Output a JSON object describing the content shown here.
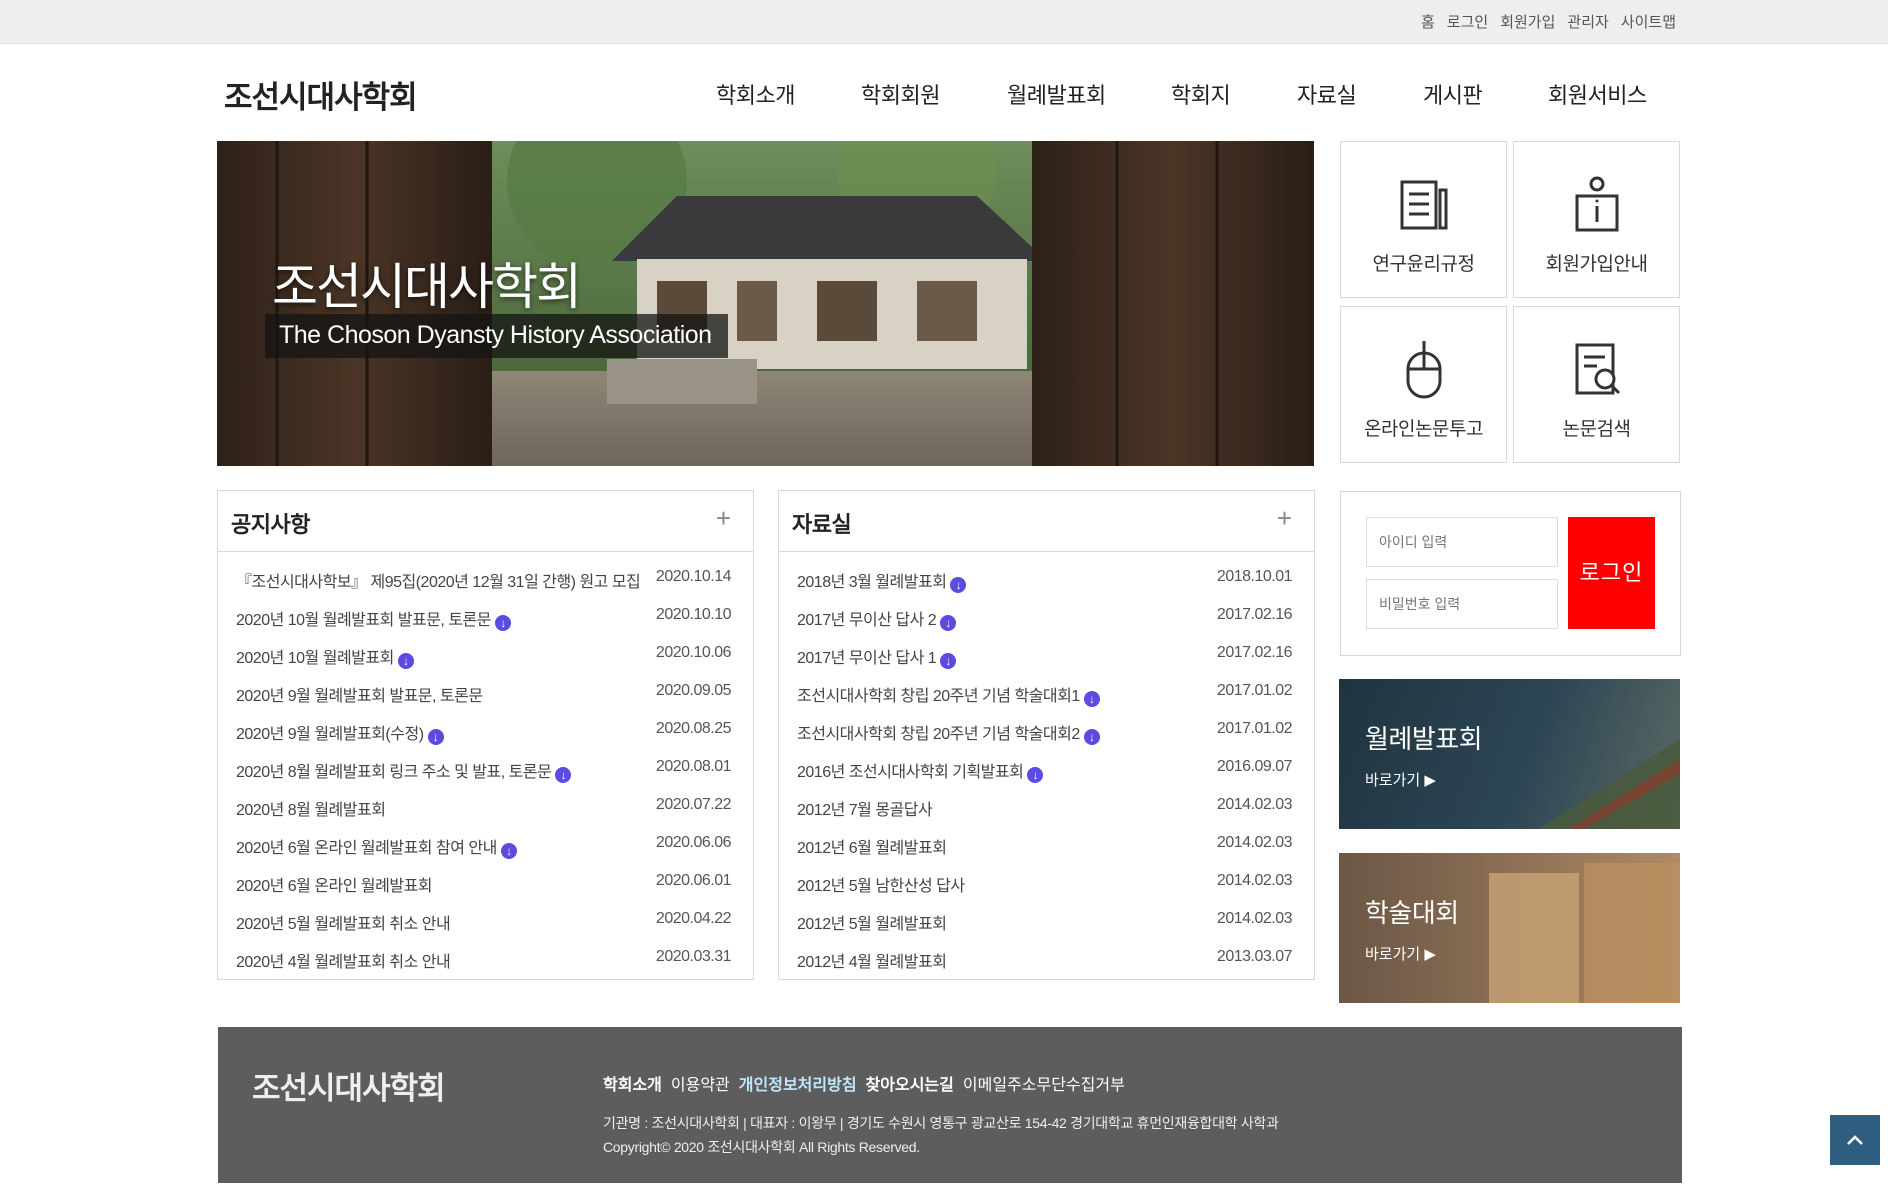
{
  "topbar": {
    "links": [
      "홈",
      "로그인",
      "회원가입",
      "관리자",
      "사이트맵"
    ]
  },
  "site": {
    "logo": "조선시대사학회"
  },
  "nav": {
    "items": [
      "학회소개",
      "학회회원",
      "월례발표회",
      "학회지",
      "자료실",
      "게시판",
      "회원서비스"
    ]
  },
  "hero": {
    "title": "조선시대사학회",
    "subtitle": "The Choson Dyansty History Association"
  },
  "quick_links": [
    {
      "label": "연구윤리규정",
      "icon": "document-pen-icon"
    },
    {
      "label": "회원가입안내",
      "icon": "person-info-icon"
    },
    {
      "label": "온라인논문투고",
      "icon": "mouse-icon"
    },
    {
      "label": "논문검색",
      "icon": "document-search-icon"
    }
  ],
  "notice": {
    "title": "공지사항",
    "more": "+",
    "items": [
      {
        "title": "『조선시대사학보』 제95집(2020년 12월 31일 간행) 원고 모집",
        "date": "2020.10.14",
        "attach": false
      },
      {
        "title": "2020년 10월 월례발표회 발표문, 토론문",
        "date": "2020.10.10",
        "attach": true
      },
      {
        "title": "2020년 10월 월례발표회",
        "date": "2020.10.06",
        "attach": true
      },
      {
        "title": "2020년 9월 월례발표회 발표문, 토론문",
        "date": "2020.09.05",
        "attach": false
      },
      {
        "title": "2020년 9월 월례발표회(수정)",
        "date": "2020.08.25",
        "attach": true
      },
      {
        "title": "2020년 8월 월례발표회 링크 주소 및 발표, 토론문",
        "date": "2020.08.01",
        "attach": true
      },
      {
        "title": "2020년 8월 월례발표회",
        "date": "2020.07.22",
        "attach": false
      },
      {
        "title": "2020년 6월 온라인 월례발표회 참여 안내",
        "date": "2020.06.06",
        "attach": true
      },
      {
        "title": "2020년 6월 온라인 월례발표회",
        "date": "2020.06.01",
        "attach": false
      },
      {
        "title": "2020년 5월 월례발표회 취소 안내",
        "date": "2020.04.22",
        "attach": false
      },
      {
        "title": "2020년 4월 월례발표회 취소 안내",
        "date": "2020.03.31",
        "attach": false
      }
    ]
  },
  "archive": {
    "title": "자료실",
    "more": "+",
    "items": [
      {
        "title": "2018년 3월 월례발표회",
        "date": "2018.10.01",
        "attach": true
      },
      {
        "title": "2017년 무이산 답사 2",
        "date": "2017.02.16",
        "attach": true
      },
      {
        "title": "2017년 무이산 답사 1",
        "date": "2017.02.16",
        "attach": true
      },
      {
        "title": "조선시대사학회 창립 20주년 기념 학술대회1",
        "date": "2017.01.02",
        "attach": true
      },
      {
        "title": "조선시대사학회 창립 20주년 기념 학술대회2",
        "date": "2017.01.02",
        "attach": true
      },
      {
        "title": "2016년 조선시대사학회 기획발표회",
        "date": "2016.09.07",
        "attach": true
      },
      {
        "title": "2012년 7월 몽골답사",
        "date": "2014.02.03",
        "attach": false
      },
      {
        "title": "2012년 6월 월례발표회",
        "date": "2014.02.03",
        "attach": false
      },
      {
        "title": "2012년 5월 남한산성 답사",
        "date": "2014.02.03",
        "attach": false
      },
      {
        "title": "2012년 5월 월례발표회",
        "date": "2014.02.03",
        "attach": false
      },
      {
        "title": "2012년 4월 월례발표회",
        "date": "2013.03.07",
        "attach": false
      }
    ]
  },
  "login": {
    "id_placeholder": "아이디 입력",
    "pw_placeholder": "비밀번호 입력",
    "button": "로그인"
  },
  "banners": [
    {
      "title": "월례발표회",
      "go": "바로가기 ▶"
    },
    {
      "title": "학술대회",
      "go": "바로가기 ▶"
    }
  ],
  "footer": {
    "logo": "조선시대사학회",
    "menu": [
      {
        "label": "학회소개",
        "bold": true,
        "color": "#ffffff"
      },
      {
        "label": "이용약관",
        "bold": false,
        "color": "#ffffff"
      },
      {
        "label": "개인정보처리방침",
        "bold": true,
        "color": "#bfe8ff"
      },
      {
        "label": "찾아오시는길",
        "bold": true,
        "color": "#ffffff"
      },
      {
        "label": "이메일주소무단수집거부",
        "bold": false,
        "color": "#ffffff"
      }
    ],
    "info_line1": "기관명 : 조선시대사학회 | 대표자 : 이왕무 | 경기도 수원시 영통구 광교산로 154-42 경기대학교 휴먼인재융합대학 사학과",
    "info_line2": "Copyright© 2020 조선시대사학회 All Rights Reserved."
  },
  "colors": {
    "login_button": "#ff0000",
    "attach_badge": "#5b4be0",
    "footer_bg": "#5d5d5d",
    "top_button": "#2f5f80"
  }
}
